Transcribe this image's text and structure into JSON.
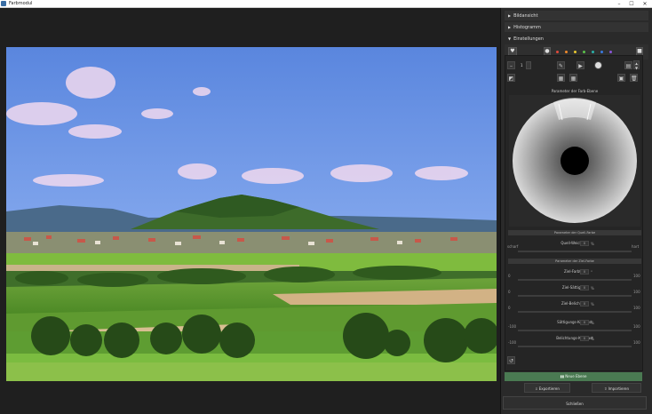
{
  "window": {
    "title": "Farbmodul",
    "min": "–",
    "max": "☐",
    "close": "✕"
  },
  "sections": {
    "overview": "Bildansicht",
    "histogram": "Histogramm",
    "settings": "Einstellungen"
  },
  "colors": {
    "dots": [
      "#888888",
      "#e24a3b",
      "#f08a2a",
      "#e8c830",
      "#5bc24a",
      "#2ab0a8",
      "#3a7ae0",
      "#8a55d8"
    ]
  },
  "tools": {
    "count_value": "1"
  },
  "wheel": {
    "title": "Parameter der Farb-Ebene"
  },
  "source": {
    "header": "Parameter der Quell-Farbe",
    "label": "Quell-Weichheit",
    "left": "scharf",
    "right": "hart",
    "value": "0",
    "unit": "%"
  },
  "target": {
    "header": "Parameter der Ziel-Farbe",
    "rows": [
      {
        "label": "Ziel-Farbton",
        "min": "0",
        "max": "100",
        "value": "0",
        "unit": "°"
      },
      {
        "label": "Ziel-Sättigung",
        "min": "0",
        "max": "100",
        "value": "0",
        "unit": "%"
      },
      {
        "label": "Ziel-Belichtung",
        "min": "0",
        "max": "100",
        "value": "0",
        "unit": "%"
      },
      {
        "label": "Sättigungs-Kontrast",
        "min": "-100",
        "max": "100",
        "value": "0",
        "unit": "%"
      },
      {
        "label": "Belichtungs-Kontrast",
        "min": "-100",
        "max": "100",
        "value": "0",
        "unit": "%"
      }
    ]
  },
  "buttons": {
    "new_layer": "Neue Ebene",
    "export": "Exportieren",
    "import": "Importieren",
    "close": "Schließen"
  }
}
